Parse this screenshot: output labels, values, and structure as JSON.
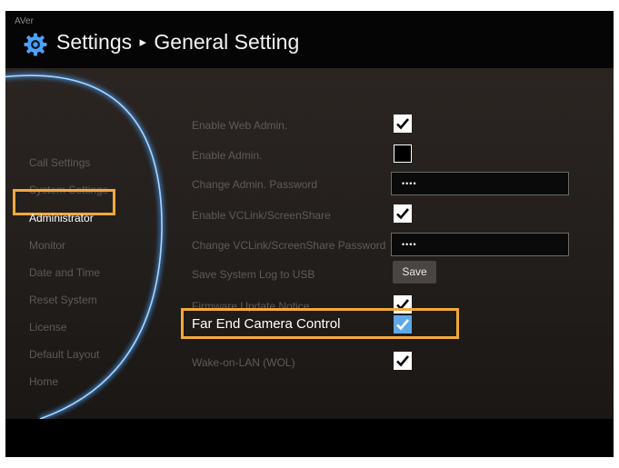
{
  "header": {
    "brand": "AVer",
    "title": "Settings",
    "subtitle": "General Setting",
    "separator": "▸"
  },
  "sidebar": {
    "items": [
      {
        "label": "Call Settings"
      },
      {
        "label": "System Settings"
      },
      {
        "label": "Administrator",
        "active": true
      },
      {
        "label": "Monitor"
      },
      {
        "label": "Date and Time"
      },
      {
        "label": "Reset System"
      },
      {
        "label": "License"
      },
      {
        "label": "Default Layout"
      },
      {
        "label": "Home"
      }
    ]
  },
  "settings": {
    "enable_web_admin": {
      "label": "Enable Web Admin.",
      "checked": true
    },
    "enable_admin": {
      "label": "Enable Admin.",
      "checked": false
    },
    "change_admin_password": {
      "label": "Change Admin. Password",
      "value": "••••"
    },
    "enable_vclink": {
      "label": "Enable VCLink/ScreenShare",
      "checked": true
    },
    "change_vclink_password": {
      "label": "Change VCLink/ScreenShare Password",
      "value": "••••"
    },
    "save_log": {
      "label": "Save System Log to USB",
      "button": "Save"
    },
    "firmware_notice": {
      "label": "Firmware Update Notice",
      "checked": true
    },
    "far_end_camera": {
      "label": "Far End Camera Control",
      "checked": true
    },
    "wake_on_lan": {
      "label": "Wake-on-LAN (WOL)",
      "checked": true
    }
  },
  "colors": {
    "highlight": "#f2a93b",
    "arc": "#6fb6ff",
    "selected_checkbox": "#5fa8e8"
  },
  "icons": [
    "gear-icon",
    "checkmark-icon"
  ]
}
